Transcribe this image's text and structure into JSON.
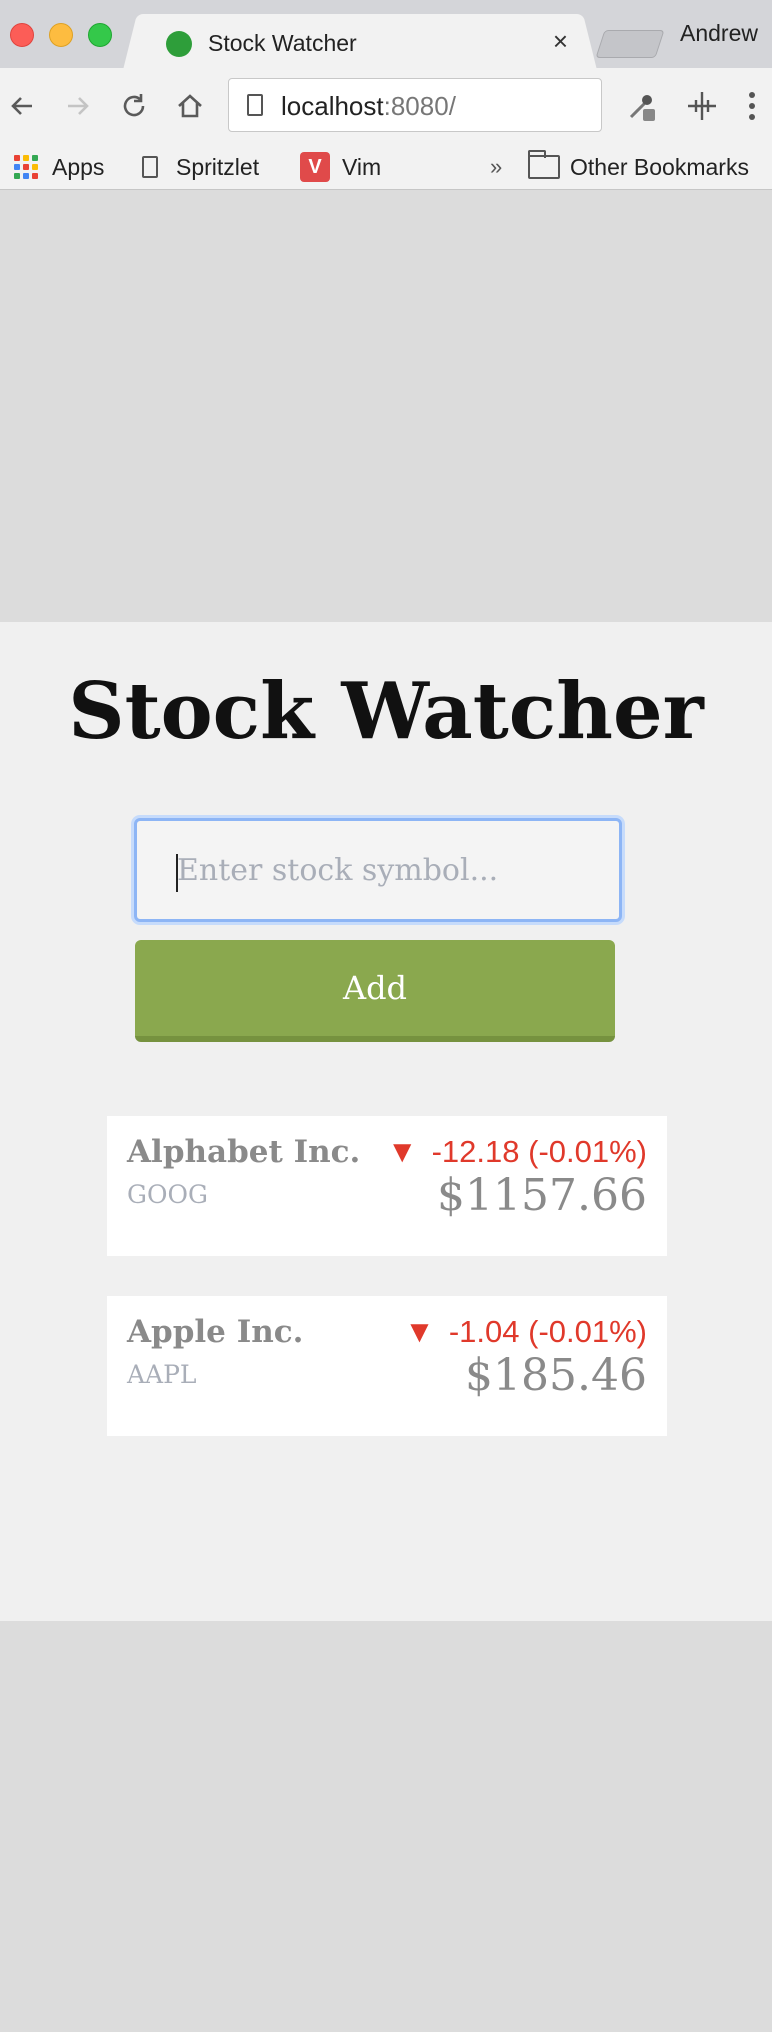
{
  "browser": {
    "tab_title": "Stock Watcher",
    "profile_name": "Andrew",
    "url_host": "localhost",
    "url_rest": ":8080/",
    "close_glyph": "×",
    "bookmarks": [
      {
        "label": "Apps",
        "icon": "apps-grid-icon"
      },
      {
        "label": "Spritzlet",
        "icon": "document-icon"
      },
      {
        "label": "Vim",
        "icon": "vim-icon",
        "badge": "V"
      },
      {
        "label": "Other Bookmarks",
        "icon": "folder-icon"
      }
    ],
    "overflow_glyph": "»"
  },
  "app": {
    "title": "Stock Watcher",
    "input_placeholder": "Enter stock symbol...",
    "add_label": "Add",
    "stocks": [
      {
        "name": "Alphabet Inc.",
        "symbol": "GOOG",
        "arrow": "▼",
        "change": "-12.18 (-0.01%)",
        "price": "$1157.66"
      },
      {
        "name": "Apple Inc.",
        "symbol": "AAPL",
        "arrow": "▼",
        "change": "-1.04 (-0.01%)",
        "price": "$185.46"
      }
    ]
  },
  "colors": {
    "accent_green": "#8aa84e",
    "negative_red": "#e0392b",
    "focus_blue": "#8db5f5"
  }
}
